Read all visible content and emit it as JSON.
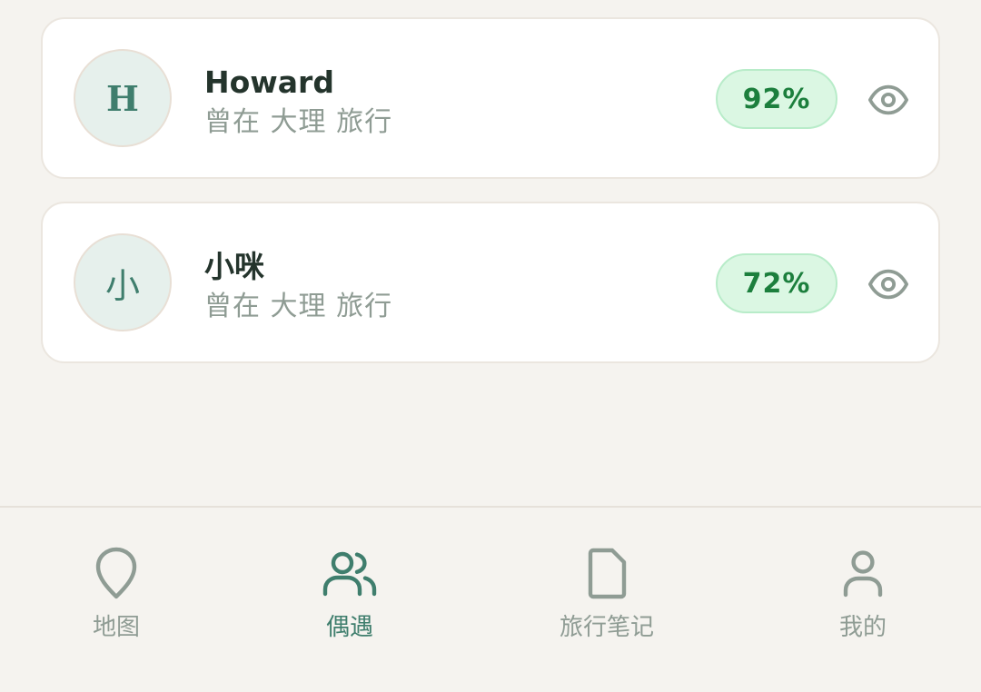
{
  "colors": {
    "accent": "#3f7e6d",
    "muted": "#8f9c94",
    "badge_text": "#1c7f3d",
    "badge_bg": "#dbf7e3",
    "background": "#f5f3ef"
  },
  "matches": [
    {
      "avatar_initial": "H",
      "name": "Howard",
      "subtitle": "曾在 大理 旅行",
      "match_percent": "92%",
      "action_icon": "eye-icon"
    },
    {
      "avatar_initial": "小",
      "name": "小咪",
      "subtitle": "曾在 大理 旅行",
      "match_percent": "72%",
      "action_icon": "eye-icon"
    }
  ],
  "tabbar": {
    "active": "偶遇",
    "items": [
      {
        "label": "地图",
        "icon": "map-pin-icon"
      },
      {
        "label": "偶遇",
        "icon": "users-icon"
      },
      {
        "label": "旅行笔记",
        "icon": "note-icon"
      },
      {
        "label": "我的",
        "icon": "user-icon"
      }
    ]
  }
}
